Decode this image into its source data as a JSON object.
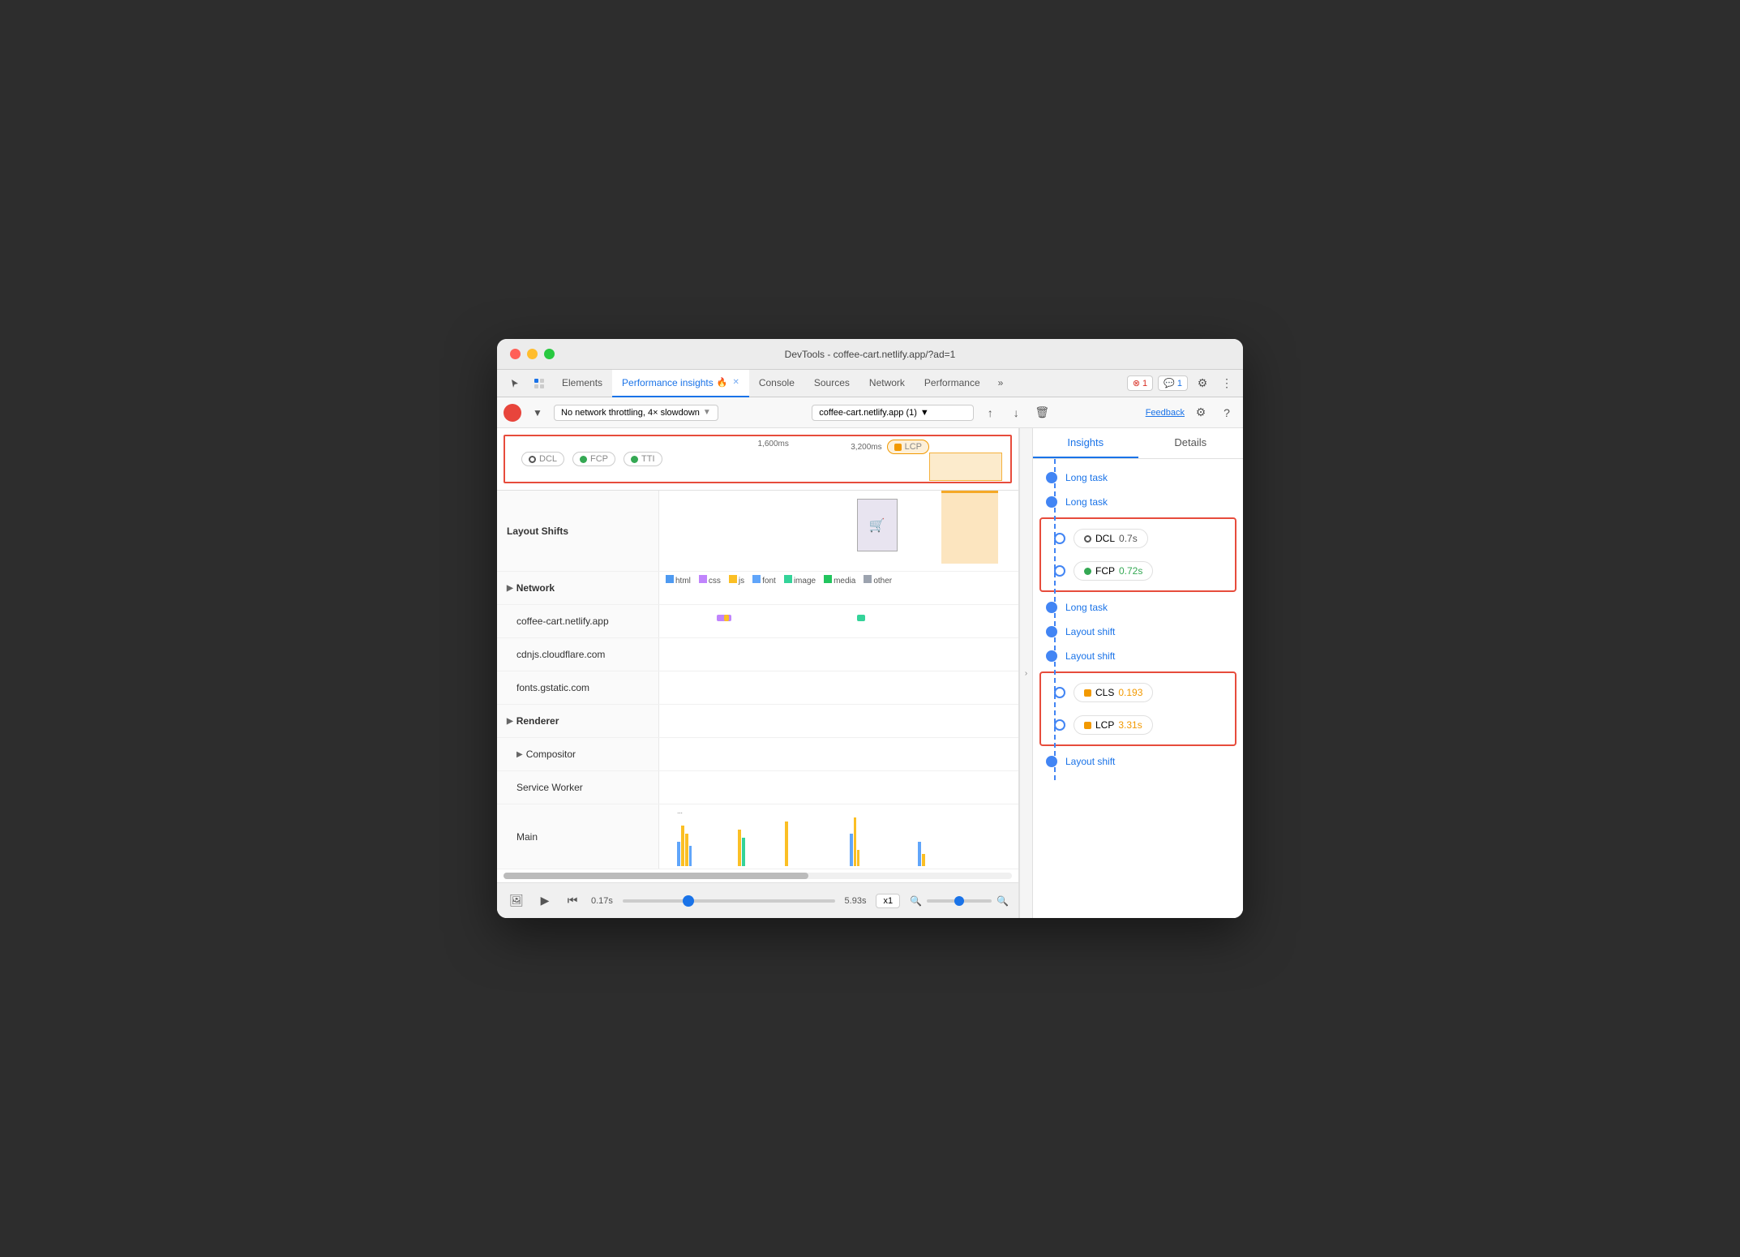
{
  "window": {
    "title": "DevTools - coffee-cart.netlify.app/?ad=1"
  },
  "tabs": {
    "elements": "Elements",
    "performance_insights": "Performance insights",
    "console": "Console",
    "sources": "Sources",
    "network": "Network",
    "performance": "Performance",
    "more": "»",
    "badge_error": "1",
    "badge_chat": "1"
  },
  "toolbar": {
    "throttle": "No network throttling, 4× slowdown",
    "url": "coffee-cart.netlify.app (1)",
    "feedback": "Feedback"
  },
  "timeline": {
    "marker_1600": "1,600ms",
    "marker_3200": "3,200ms",
    "metrics": {
      "dcl": "DCL",
      "fcp": "FCP",
      "tti": "TTI",
      "lcp": "LCP"
    }
  },
  "sections": {
    "layout_shifts": "Layout Shifts",
    "network": "Network",
    "renderer": "Renderer",
    "compositor": "Compositor",
    "service_worker": "Service Worker",
    "main": "Main",
    "network_hosts": [
      "coffee-cart.netlify.app",
      "cdnjs.cloudflare.com",
      "fonts.gstatic.com"
    ]
  },
  "network_legend": [
    "html",
    "css",
    "js",
    "font",
    "image",
    "media",
    "other"
  ],
  "playback": {
    "start_time": "0.17s",
    "end_time": "5.93s",
    "speed": "x1",
    "scrubber_val": "30"
  },
  "insights": {
    "tab_insights": "Insights",
    "tab_details": "Details",
    "items": [
      {
        "type": "link",
        "label": "Long task",
        "dot": "filled"
      },
      {
        "type": "link",
        "label": "Long task",
        "dot": "filled"
      },
      {
        "type": "metric",
        "label": "DCL",
        "value": "0.7s",
        "color": "neutral",
        "dot": "hollow",
        "boxed_start": true
      },
      {
        "type": "metric",
        "label": "FCP",
        "value": "0.72s",
        "color": "green",
        "dot": "hollow",
        "boxed_end": true
      },
      {
        "type": "link",
        "label": "Long task",
        "dot": "filled"
      },
      {
        "type": "link",
        "label": "Layout shift",
        "dot": "filled"
      },
      {
        "type": "link",
        "label": "Layout shift",
        "dot": "filled"
      },
      {
        "type": "metric",
        "label": "CLS",
        "value": "0.193",
        "color": "orange",
        "dot": "hollow",
        "boxed_start": true
      },
      {
        "type": "metric",
        "label": "LCP",
        "value": "3.31s",
        "color": "orange",
        "dot": "hollow",
        "boxed_end": true
      },
      {
        "type": "link",
        "label": "Layout shift",
        "dot": "filled"
      }
    ]
  }
}
